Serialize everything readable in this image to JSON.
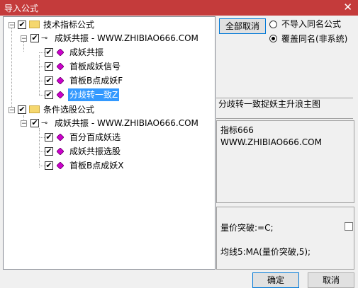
{
  "window": {
    "title": "导入公式",
    "close_icon": "close-icon"
  },
  "tree": {
    "groups": [
      {
        "label": "技术指标公式",
        "file": "成妖共振 - WWW.ZHIBIAO666.COM",
        "items": [
          "成妖共振",
          "首板成妖信号",
          "首板B点成妖F",
          "分歧转一致Z"
        ]
      },
      {
        "label": "条件选股公式",
        "file": "成妖共振 - WWW.ZHIBIAO666.COM",
        "items": [
          "百分百成妖选",
          "成妖共振选股",
          "首板B点成妖X"
        ]
      }
    ],
    "selected_item": "分歧转一致Z",
    "colors": {
      "folder": "#f5d76e",
      "gem": "#cc00cc",
      "selection": "#3399ff"
    }
  },
  "options": {
    "clear_all_label": "全部取消",
    "radio1_label": "不导入同名公式",
    "radio2_label": "覆盖同名(非系统)",
    "selected_radio": "覆盖同名(非系统)"
  },
  "info": {
    "description": "分歧转一致捉妖主升浪主图",
    "note_line1": "指标666",
    "note_line2": "WWW.ZHIBIAO666.COM",
    "code_line1": "量价突破:=C;",
    "code_line2": "均线5:MA(量价突破,5);"
  },
  "footer": {
    "ok_label": "确定",
    "cancel_label": "取消"
  }
}
